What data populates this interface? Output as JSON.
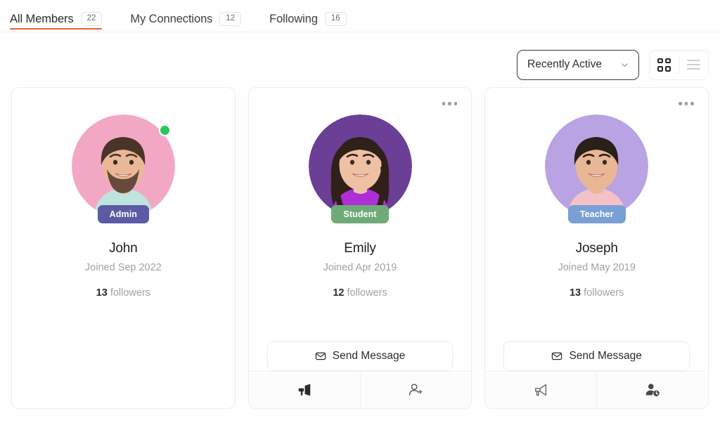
{
  "tabs": [
    {
      "label": "All Members",
      "count": "22",
      "active": true
    },
    {
      "label": "My Connections",
      "count": "12",
      "active": false
    },
    {
      "label": "Following",
      "count": "16",
      "active": false
    }
  ],
  "toolbar": {
    "sort_value": "Recently Active",
    "chevron_icon": "chevron-down-icon",
    "grid_view_icon": "grid-view-icon",
    "list_view_icon": "list-view-icon",
    "active_view": "grid"
  },
  "colors": {
    "accent": "#e8613a",
    "admin_badge": "#5b5ba5",
    "student_badge": "#6faa79",
    "teacher_badge": "#79a0d4",
    "online_dot": "#25c75a",
    "card_border": "#ededed",
    "text_primary": "#1d1d1d",
    "text_muted": "#a2a2a2"
  },
  "members": [
    {
      "name": "John",
      "joined": "Joined Sep 2022",
      "followers_count": "13",
      "followers_label": "followers",
      "role": "Admin",
      "role_color": "#5b5ba5",
      "online": true,
      "has_menu": false,
      "has_message_button": false,
      "has_footer": false,
      "avatar_bg": "#f2a8c4",
      "shirt_color": "#bfe3dd",
      "hair_color": "#4a342a",
      "skin_color": "#e9b896",
      "beard": true,
      "long_hair": false
    },
    {
      "name": "Emily",
      "joined": "Joined Apr 2019",
      "followers_count": "12",
      "followers_label": "followers",
      "role": "Student",
      "role_color": "#6faa79",
      "online": false,
      "has_menu": true,
      "has_message_button": true,
      "has_footer": true,
      "message_label": "Send Message",
      "message_icon": "envelope-icon",
      "footer_left_icon": "megaphone-solid-icon",
      "footer_right_icon": "add-person-icon",
      "avatar_bg": "#6b3f96",
      "shirt_color": "#ae2fd6",
      "hair_color": "#30201a",
      "skin_color": "#eec1a4",
      "beard": false,
      "long_hair": true
    },
    {
      "name": "Joseph",
      "joined": "Joined May 2019",
      "followers_count": "13",
      "followers_label": "followers",
      "role": "Teacher",
      "role_color": "#79a0d4",
      "online": false,
      "has_menu": true,
      "has_message_button": true,
      "has_footer": true,
      "message_label": "Send Message",
      "message_icon": "envelope-icon",
      "footer_left_icon": "megaphone-outline-icon",
      "footer_right_icon": "person-pending-icon",
      "avatar_bg": "#b9a3e3",
      "shirt_color": "#f4c2c6",
      "hair_color": "#2b1f19",
      "skin_color": "#e8b795",
      "beard": false,
      "long_hair": false
    }
  ]
}
